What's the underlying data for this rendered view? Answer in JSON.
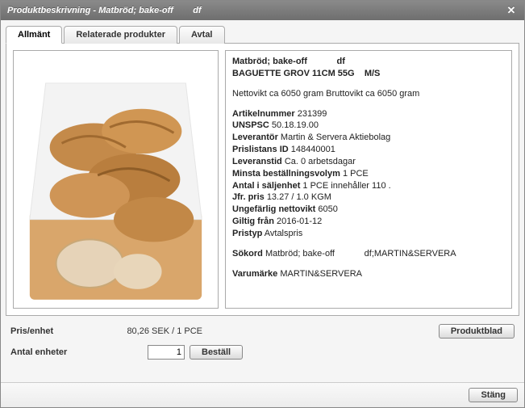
{
  "window": {
    "title": "Produktbeskrivning - Matbröd; bake-off        df"
  },
  "tabs": {
    "t0": "Allmänt",
    "t1": "Relaterade produkter",
    "t2": "Avtal"
  },
  "product": {
    "name_line1": "Matbröd; bake-off            df",
    "name_line2": "BAGUETTE GROV 11CM 55G    M/S",
    "weight_line": "Nettovikt ca 6050 gram Bruttovikt ca 6050 gram",
    "labels": {
      "artnr": "Artikelnummer",
      "unspsc": "UNSPSC",
      "supplier": "Leverantör",
      "pricelist_id": "Prislistans ID",
      "lead_time": "Leveranstid",
      "min_qty": "Minsta beställningsvolym",
      "pack_qty": "Antal i säljenhet",
      "comp_price": "Jfr. pris",
      "approx_net": "Ungefärlig nettovikt",
      "valid_from": "Giltig från",
      "price_type": "Pristyp",
      "keywords": "Sökord",
      "brand": "Varumärke"
    },
    "values": {
      "artnr": "231399",
      "unspsc": "50.18.19.00",
      "supplier": "Martin & Servera Aktiebolag",
      "pricelist_id": "148440001",
      "lead_time": "Ca. 0 arbetsdagar",
      "min_qty": "1 PCE",
      "pack_qty": "1 PCE innehåller 110 .",
      "comp_price": "13.27  / 1.0 KGM",
      "approx_net": "6050",
      "valid_from": "2016-01-12",
      "price_type": "Avtalspris",
      "keywords": "Matbröd; bake-off            df;MARTIN&SERVERA",
      "brand": "MARTIN&SERVERA"
    }
  },
  "footer": {
    "price_unit_label": "Pris/enhet",
    "price_unit_value": "80,26 SEK  / 1 PCE",
    "qty_label": "Antal enheter",
    "qty_value": "1",
    "order_btn": "Beställ",
    "datasheet_btn": "Produktblad",
    "close_btn": "Stäng"
  }
}
